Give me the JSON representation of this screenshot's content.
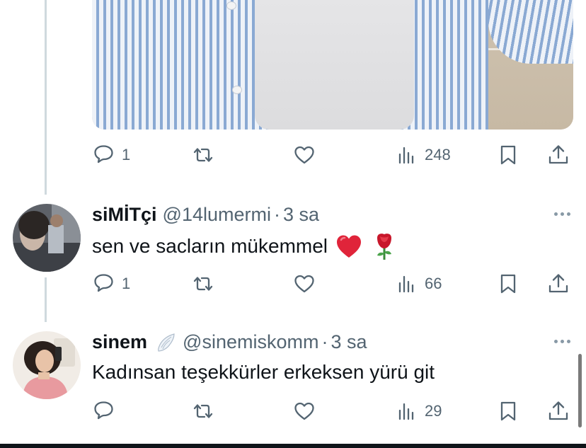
{
  "original_tweet": {
    "actions": {
      "reply_count": "1",
      "retweet_count": "",
      "like_count": "",
      "views_count": "248"
    }
  },
  "replies": [
    {
      "display_name": "siMİTçi",
      "handle": "@14lumermi",
      "separator": "·",
      "time": "3 sa",
      "text": "sen ve sacların mükemmel",
      "emojis": [
        "red-heart",
        "rose"
      ],
      "actions": {
        "reply_count": "1",
        "retweet_count": "",
        "like_count": "",
        "views_count": "66"
      }
    },
    {
      "display_name": "sinem",
      "name_emoji": "wing",
      "handle": "@sinemiskomm",
      "separator": "·",
      "time": "3 sa",
      "text": "Kadınsan teşekkürler erkeksen yürü git",
      "actions": {
        "reply_count": "",
        "retweet_count": "",
        "like_count": "",
        "views_count": "29"
      }
    }
  ],
  "icons": {
    "reply": "speech-bubble-icon",
    "retweet": "retweet-icon",
    "like": "heart-icon",
    "views": "bar-chart-icon",
    "bookmark": "bookmark-icon",
    "share": "share-upload-icon",
    "more": "more-horizontal-icon"
  },
  "colors": {
    "text_primary": "#0f1419",
    "text_secondary": "#536471",
    "thread_line": "#cfd9de",
    "heart_red": "#e0243a"
  }
}
